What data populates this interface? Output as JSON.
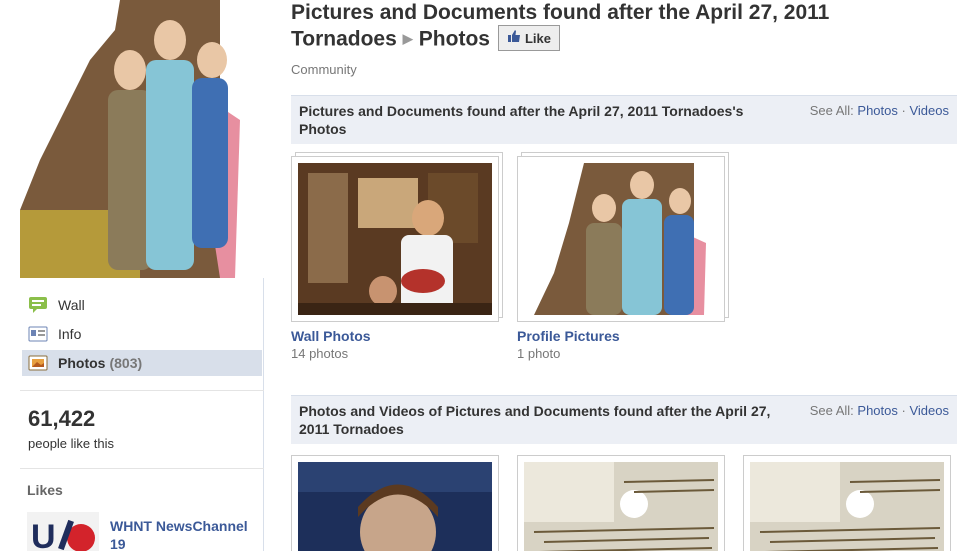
{
  "header": {
    "page_title": "Pictures and Documents found after the April 27, 2011 Tornadoes",
    "section": "Photos",
    "like_button": "Like",
    "category": "Community"
  },
  "sidebar": {
    "items": [
      {
        "label": "Wall",
        "icon": "wall-icon"
      },
      {
        "label": "Info",
        "icon": "info-icon"
      },
      {
        "label": "Photos",
        "count": "(803)",
        "icon": "photos-icon"
      }
    ],
    "fans_count": "61,422",
    "fans_label": "people like this",
    "likes_heading": "Likes",
    "liked_page": "WHNT NewsChannel 19"
  },
  "albums_section": {
    "title": "Pictures and Documents found after the April 27, 2011 Tornadoes's Photos",
    "see_all_prefix": "See All:",
    "see_all_photos": "Photos",
    "separator": "·",
    "see_all_videos": "Videos",
    "albums": [
      {
        "name": "Wall Photos",
        "count": "14 photos"
      },
      {
        "name": "Profile Pictures",
        "count": "1 photo"
      }
    ]
  },
  "tagged_section": {
    "title": "Photos and Videos of Pictures and Documents found after the April 27, 2011 Tornadoes",
    "see_all_prefix": "See All:",
    "see_all_photos": "Photos",
    "separator": "·",
    "see_all_videos": "Videos"
  },
  "colors": {
    "link": "#3b5998",
    "header_bg": "#eceff5",
    "active_nav_bg": "#d8dfea"
  }
}
